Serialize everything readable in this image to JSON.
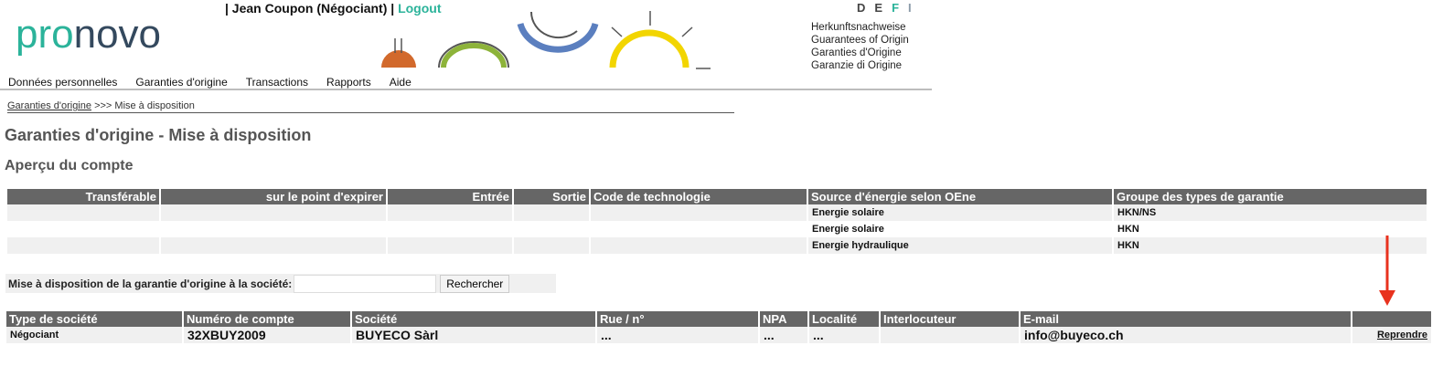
{
  "brand": {
    "part1": "pro",
    "part2": "novo"
  },
  "user": {
    "label": "| Jean Coupon (Négociant) |",
    "logout": "Logout"
  },
  "languages": [
    "D",
    "E",
    "F",
    "I"
  ],
  "active_language": "F",
  "claims": [
    "Herkunftsnachweise",
    "Guarantees of Origin",
    "Garanties d'Origine",
    "Garanzie di Origine"
  ],
  "nav": [
    "Données personnelles",
    "Garanties d'origine",
    "Transactions",
    "Rapports",
    "Aide"
  ],
  "breadcrumb": {
    "parent": "Garanties d'origine",
    "separator": ">>>",
    "current": "Mise à disposition"
  },
  "page_title": "Garanties d'origine - Mise à disposition",
  "section_title": "Aperçu du compte",
  "account_table": {
    "headers": [
      "Transférable",
      "sur le point d'expirer",
      "Entrée",
      "Sortie",
      "Code de technologie",
      "Source d'énergie selon OEne",
      "Groupe des types de garantie"
    ],
    "rows": [
      [
        "",
        "",
        "",
        "",
        "",
        "Energie solaire",
        "HKN/NS"
      ],
      [
        "",
        "",
        "",
        "",
        "",
        "Energie solaire",
        "HKN"
      ],
      [
        "",
        "",
        "",
        "",
        "",
        "Energie hydraulique",
        "HKN"
      ]
    ]
  },
  "search": {
    "label": "Mise à disposition de la garantie d'origine à la société:",
    "value": "",
    "button": "Rechercher"
  },
  "company_table": {
    "headers": [
      "Type de société",
      "Numéro de compte",
      "Société",
      "Rue / n°",
      "NPA",
      "Localité",
      "Interlocuteur",
      "E-mail",
      ""
    ],
    "row": {
      "type": "Négociant",
      "account": "32XBUY2009",
      "company": "BUYECO Sàrl",
      "street": "...",
      "npa": "...",
      "city": "...",
      "contact": "",
      "email": "info@buyeco.ch",
      "action": "Reprendre"
    }
  },
  "colors": {
    "brand_green": "#2bb39a",
    "brand_navy": "#34495e",
    "header_gray": "#666666",
    "arrow_red": "#e8321e"
  }
}
